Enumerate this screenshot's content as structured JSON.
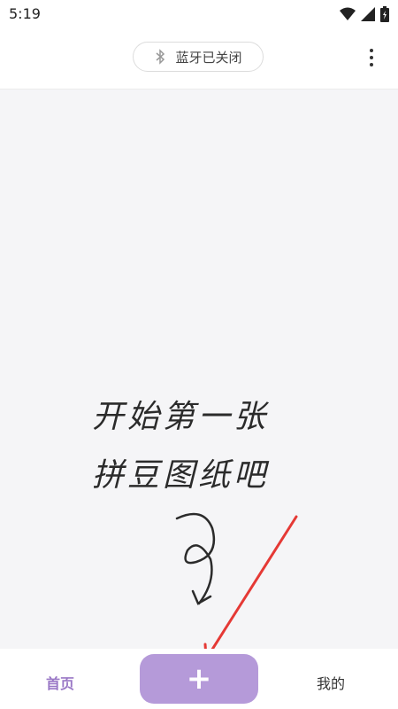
{
  "status_bar": {
    "time": "5:19",
    "icons": [
      "wifi-icon",
      "signal-icon",
      "battery-icon"
    ]
  },
  "header": {
    "bluetooth_status": "蓝牙已关闭",
    "bluetooth_icon": "bluetooth-off-icon",
    "more_icon": "more-vertical-icon"
  },
  "canvas": {
    "hint_line1": "开始第一张",
    "hint_line2": "拼豆图纸吧",
    "arrow_color": "#e53935"
  },
  "bottom_nav": {
    "home_label": "首页",
    "add_icon": "+",
    "mine_label": "我的",
    "accent_color": "#b59ad9"
  }
}
